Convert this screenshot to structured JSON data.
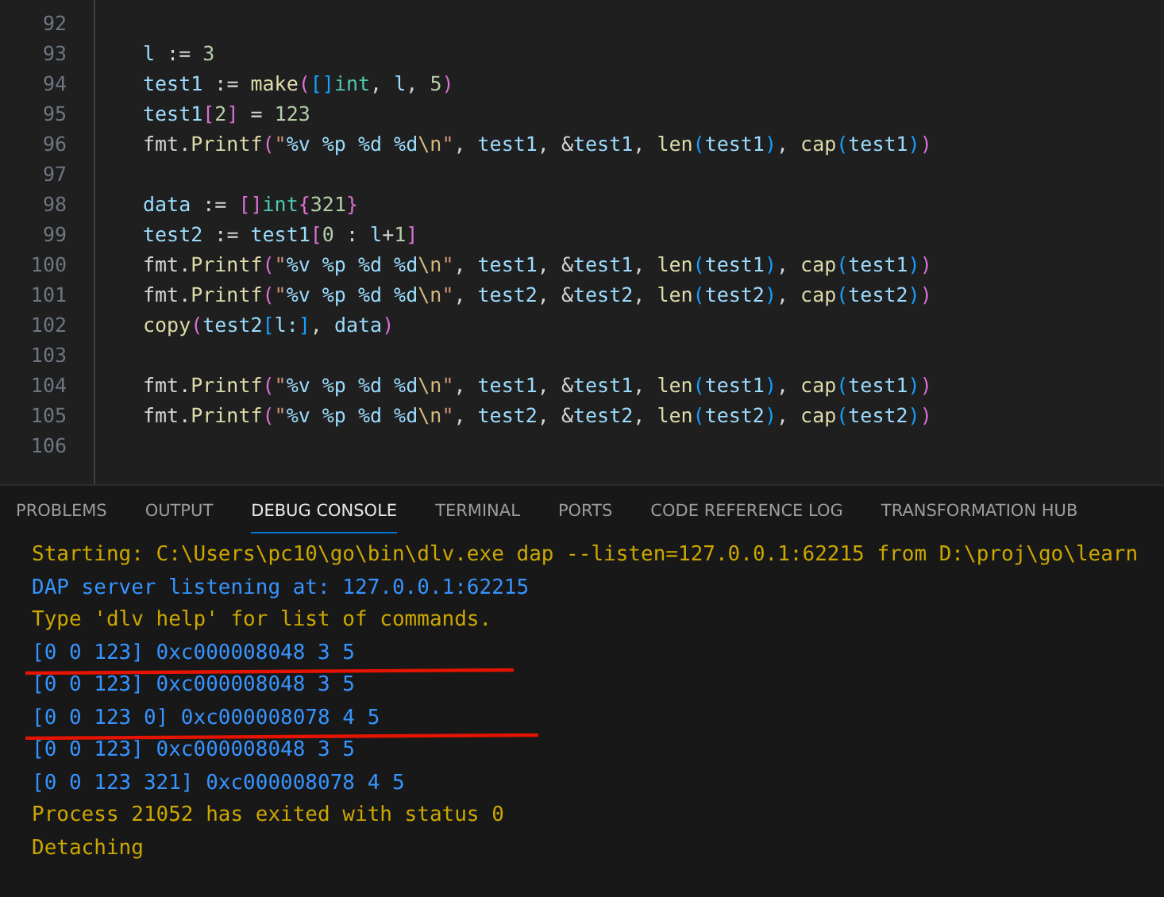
{
  "editor": {
    "lines": [
      {
        "number": "92"
      },
      {
        "number": "93",
        "tokens": [
          {
            "text": "l",
            "kind": "v"
          },
          {
            "text": " := ",
            "kind": "o"
          },
          {
            "text": "3",
            "kind": "n"
          }
        ]
      },
      {
        "number": "94",
        "tokens": [
          {
            "text": "test1",
            "kind": "v"
          },
          {
            "text": " := ",
            "kind": "o"
          },
          {
            "text": "make",
            "kind": "f"
          },
          {
            "text": "(",
            "kind": "p2"
          },
          {
            "text": "[]",
            "kind": "p3"
          },
          {
            "text": "int",
            "kind": "t"
          },
          {
            "text": ", ",
            "kind": "o"
          },
          {
            "text": "l",
            "kind": "v"
          },
          {
            "text": ", ",
            "kind": "o"
          },
          {
            "text": "5",
            "kind": "n"
          },
          {
            "text": ")",
            "kind": "p2"
          }
        ]
      },
      {
        "number": "95",
        "tokens": [
          {
            "text": "test1",
            "kind": "v"
          },
          {
            "text": "[",
            "kind": "p2"
          },
          {
            "text": "2",
            "kind": "n"
          },
          {
            "text": "]",
            "kind": "p2"
          },
          {
            "text": " = ",
            "kind": "o"
          },
          {
            "text": "123",
            "kind": "n"
          }
        ]
      },
      {
        "number": "96",
        "tokens": [
          {
            "text": "fmt.",
            "kind": "o"
          },
          {
            "text": "Printf",
            "kind": "f"
          },
          {
            "text": "(",
            "kind": "p2"
          },
          {
            "text": "\"",
            "kind": "s"
          },
          {
            "text": "%v %p %d %d",
            "kind": "fs"
          },
          {
            "text": "\\n",
            "kind": "e"
          },
          {
            "text": "\"",
            "kind": "s"
          },
          {
            "text": ", ",
            "kind": "o"
          },
          {
            "text": "test1",
            "kind": "v"
          },
          {
            "text": ", &",
            "kind": "o"
          },
          {
            "text": "test1",
            "kind": "v"
          },
          {
            "text": ", ",
            "kind": "o"
          },
          {
            "text": "len",
            "kind": "f"
          },
          {
            "text": "(",
            "kind": "p3"
          },
          {
            "text": "test1",
            "kind": "v"
          },
          {
            "text": ")",
            "kind": "p3"
          },
          {
            "text": ", ",
            "kind": "o"
          },
          {
            "text": "cap",
            "kind": "f"
          },
          {
            "text": "(",
            "kind": "p3"
          },
          {
            "text": "test1",
            "kind": "v"
          },
          {
            "text": ")",
            "kind": "p3"
          },
          {
            "text": ")",
            "kind": "p2"
          }
        ]
      },
      {
        "number": "97"
      },
      {
        "number": "98",
        "tokens": [
          {
            "text": "data",
            "kind": "v"
          },
          {
            "text": " := ",
            "kind": "o"
          },
          {
            "text": "[]",
            "kind": "p2"
          },
          {
            "text": "int",
            "kind": "t"
          },
          {
            "text": "{",
            "kind": "p2"
          },
          {
            "text": "321",
            "kind": "n"
          },
          {
            "text": "}",
            "kind": "p2"
          }
        ]
      },
      {
        "number": "99",
        "tokens": [
          {
            "text": "test2",
            "kind": "v"
          },
          {
            "text": " := ",
            "kind": "o"
          },
          {
            "text": "test1",
            "kind": "v"
          },
          {
            "text": "[",
            "kind": "p2"
          },
          {
            "text": "0",
            "kind": "n"
          },
          {
            "text": " : ",
            "kind": "o"
          },
          {
            "text": "l",
            "kind": "v"
          },
          {
            "text": "+",
            "kind": "o"
          },
          {
            "text": "1",
            "kind": "n"
          },
          {
            "text": "]",
            "kind": "p2"
          }
        ]
      },
      {
        "number": "100",
        "tokens": [
          {
            "text": "fmt.",
            "kind": "o"
          },
          {
            "text": "Printf",
            "kind": "f"
          },
          {
            "text": "(",
            "kind": "p2"
          },
          {
            "text": "\"",
            "kind": "s"
          },
          {
            "text": "%v %p %d %d",
            "kind": "fs"
          },
          {
            "text": "\\n",
            "kind": "e"
          },
          {
            "text": "\"",
            "kind": "s"
          },
          {
            "text": ", ",
            "kind": "o"
          },
          {
            "text": "test1",
            "kind": "v"
          },
          {
            "text": ", &",
            "kind": "o"
          },
          {
            "text": "test1",
            "kind": "v"
          },
          {
            "text": ", ",
            "kind": "o"
          },
          {
            "text": "len",
            "kind": "f"
          },
          {
            "text": "(",
            "kind": "p3"
          },
          {
            "text": "test1",
            "kind": "v"
          },
          {
            "text": ")",
            "kind": "p3"
          },
          {
            "text": ", ",
            "kind": "o"
          },
          {
            "text": "cap",
            "kind": "f"
          },
          {
            "text": "(",
            "kind": "p3"
          },
          {
            "text": "test1",
            "kind": "v"
          },
          {
            "text": ")",
            "kind": "p3"
          },
          {
            "text": ")",
            "kind": "p2"
          }
        ]
      },
      {
        "number": "101",
        "tokens": [
          {
            "text": "fmt.",
            "kind": "o"
          },
          {
            "text": "Printf",
            "kind": "f"
          },
          {
            "text": "(",
            "kind": "p2"
          },
          {
            "text": "\"",
            "kind": "s"
          },
          {
            "text": "%v %p %d %d",
            "kind": "fs"
          },
          {
            "text": "\\n",
            "kind": "e"
          },
          {
            "text": "\"",
            "kind": "s"
          },
          {
            "text": ", ",
            "kind": "o"
          },
          {
            "text": "test2",
            "kind": "v"
          },
          {
            "text": ", &",
            "kind": "o"
          },
          {
            "text": "test2",
            "kind": "v"
          },
          {
            "text": ", ",
            "kind": "o"
          },
          {
            "text": "len",
            "kind": "f"
          },
          {
            "text": "(",
            "kind": "p3"
          },
          {
            "text": "test2",
            "kind": "v"
          },
          {
            "text": ")",
            "kind": "p3"
          },
          {
            "text": ", ",
            "kind": "o"
          },
          {
            "text": "cap",
            "kind": "f"
          },
          {
            "text": "(",
            "kind": "p3"
          },
          {
            "text": "test2",
            "kind": "v"
          },
          {
            "text": ")",
            "kind": "p3"
          },
          {
            "text": ")",
            "kind": "p2"
          }
        ]
      },
      {
        "number": "102",
        "tokens": [
          {
            "text": "copy",
            "kind": "f"
          },
          {
            "text": "(",
            "kind": "p2"
          },
          {
            "text": "test2",
            "kind": "v"
          },
          {
            "text": "[",
            "kind": "p3"
          },
          {
            "text": "l:",
            "kind": "v"
          },
          {
            "text": "]",
            "kind": "p3"
          },
          {
            "text": ", ",
            "kind": "o"
          },
          {
            "text": "data",
            "kind": "v"
          },
          {
            "text": ")",
            "kind": "p2"
          }
        ]
      },
      {
        "number": "103"
      },
      {
        "number": "104",
        "tokens": [
          {
            "text": "fmt.",
            "kind": "o"
          },
          {
            "text": "Printf",
            "kind": "f"
          },
          {
            "text": "(",
            "kind": "p2"
          },
          {
            "text": "\"",
            "kind": "s"
          },
          {
            "text": "%v %p %d %d",
            "kind": "fs"
          },
          {
            "text": "\\n",
            "kind": "e"
          },
          {
            "text": "\"",
            "kind": "s"
          },
          {
            "text": ", ",
            "kind": "o"
          },
          {
            "text": "test1",
            "kind": "v"
          },
          {
            "text": ", &",
            "kind": "o"
          },
          {
            "text": "test1",
            "kind": "v"
          },
          {
            "text": ", ",
            "kind": "o"
          },
          {
            "text": "len",
            "kind": "f"
          },
          {
            "text": "(",
            "kind": "p3"
          },
          {
            "text": "test1",
            "kind": "v"
          },
          {
            "text": ")",
            "kind": "p3"
          },
          {
            "text": ", ",
            "kind": "o"
          },
          {
            "text": "cap",
            "kind": "f"
          },
          {
            "text": "(",
            "kind": "p3"
          },
          {
            "text": "test1",
            "kind": "v"
          },
          {
            "text": ")",
            "kind": "p3"
          },
          {
            "text": ")",
            "kind": "p2"
          }
        ]
      },
      {
        "number": "105",
        "tokens": [
          {
            "text": "fmt.",
            "kind": "o"
          },
          {
            "text": "Printf",
            "kind": "f"
          },
          {
            "text": "(",
            "kind": "p2"
          },
          {
            "text": "\"",
            "kind": "s"
          },
          {
            "text": "%v %p %d %d",
            "kind": "fs"
          },
          {
            "text": "\\n",
            "kind": "e"
          },
          {
            "text": "\"",
            "kind": "s"
          },
          {
            "text": ", ",
            "kind": "o"
          },
          {
            "text": "test2",
            "kind": "v"
          },
          {
            "text": ", &",
            "kind": "o"
          },
          {
            "text": "test2",
            "kind": "v"
          },
          {
            "text": ", ",
            "kind": "o"
          },
          {
            "text": "len",
            "kind": "f"
          },
          {
            "text": "(",
            "kind": "p3"
          },
          {
            "text": "test2",
            "kind": "v"
          },
          {
            "text": ")",
            "kind": "p3"
          },
          {
            "text": ", ",
            "kind": "o"
          },
          {
            "text": "cap",
            "kind": "f"
          },
          {
            "text": "(",
            "kind": "p3"
          },
          {
            "text": "test2",
            "kind": "v"
          },
          {
            "text": ")",
            "kind": "p3"
          },
          {
            "text": ")",
            "kind": "p2"
          }
        ]
      },
      {
        "number": "106"
      }
    ]
  },
  "panel": {
    "tabs": [
      {
        "label": "PROBLEMS",
        "selected": false
      },
      {
        "label": "OUTPUT",
        "selected": false
      },
      {
        "label": "DEBUG CONSOLE",
        "selected": true
      },
      {
        "label": "TERMINAL",
        "selected": false
      },
      {
        "label": "PORTS",
        "selected": false
      },
      {
        "label": "CODE REFERENCE LOG",
        "selected": false
      },
      {
        "label": "TRANSFORMATION HUB",
        "selected": false
      }
    ],
    "console": [
      {
        "text": "Starting: C:\\Users\\pc10\\go\\bin\\dlv.exe dap --listen=127.0.0.1:62215 from D:\\proj\\go\\learn",
        "kind": "info",
        "underlined": false
      },
      {
        "text": "DAP server listening at: 127.0.0.1:62215",
        "kind": "output",
        "underlined": false
      },
      {
        "text": "Type 'dlv help' for list of commands.",
        "kind": "info",
        "underlined": false
      },
      {
        "text": "[0 0 123] 0xc000008048 3 5",
        "kind": "output",
        "underlined": true
      },
      {
        "text": "[0 0 123] 0xc000008048 3 5",
        "kind": "output",
        "underlined": false
      },
      {
        "text": "[0 0 123 0] 0xc000008078 4 5",
        "kind": "output",
        "underlined": true
      },
      {
        "text": "[0 0 123] 0xc000008048 3 5",
        "kind": "output",
        "underlined": false
      },
      {
        "text": "[0 0 123 321] 0xc000008078 4 5",
        "kind": "output",
        "underlined": false
      },
      {
        "text": "Process 21052 has exited with status 0",
        "kind": "info",
        "underlined": false
      },
      {
        "text": "Detaching",
        "kind": "info",
        "underlined": false
      }
    ]
  }
}
